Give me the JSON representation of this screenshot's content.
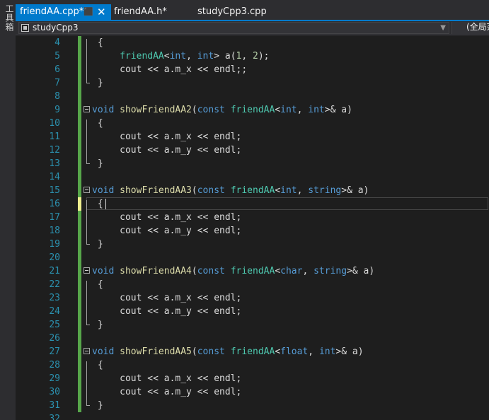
{
  "side_panel": {
    "toolbox_label": "工具箱"
  },
  "tabs": [
    {
      "label": "friendAA.cpp*",
      "active": true,
      "pin_icon": "pin-icon",
      "close_icon": "close-icon"
    },
    {
      "label": "friendAA.h*",
      "active": false
    },
    {
      "label": "studyCpp3.cpp",
      "active": false
    }
  ],
  "navbar": {
    "project": "studyCpp3",
    "scope": "(全局范围)"
  },
  "editor": {
    "lines": [
      {
        "n": "4",
        "code": [
          {
            "t": "{",
            "c": "p"
          }
        ]
      },
      {
        "n": "5",
        "code": [
          {
            "t": "    "
          },
          {
            "t": "friendAA",
            "c": "ty"
          },
          {
            "t": "<"
          },
          {
            "t": "int",
            "c": "kw"
          },
          {
            "t": ", "
          },
          {
            "t": "int",
            "c": "kw"
          },
          {
            "t": "> "
          },
          {
            "t": "a",
            "c": "mem"
          },
          {
            "t": "("
          },
          {
            "t": "1",
            "c": "num"
          },
          {
            "t": ", "
          },
          {
            "t": "2",
            "c": "num"
          },
          {
            "t": ");"
          }
        ]
      },
      {
        "n": "6",
        "code": [
          {
            "t": "    cout << a."
          },
          {
            "t": "m_x",
            "c": "mem"
          },
          {
            "t": " << endl;;"
          }
        ]
      },
      {
        "n": "7",
        "code": [
          {
            "t": "}"
          }
        ]
      },
      {
        "n": "8",
        "code": []
      },
      {
        "n": "9",
        "code": [
          {
            "t": "void",
            "c": "kw"
          },
          {
            "t": " "
          },
          {
            "t": "showFriendAA2",
            "c": "fn"
          },
          {
            "t": "("
          },
          {
            "t": "const",
            "c": "kw"
          },
          {
            "t": " "
          },
          {
            "t": "friendAA",
            "c": "ty"
          },
          {
            "t": "<"
          },
          {
            "t": "int",
            "c": "kw"
          },
          {
            "t": ", "
          },
          {
            "t": "int",
            "c": "kw"
          },
          {
            "t": ">& a)"
          }
        ]
      },
      {
        "n": "10",
        "code": [
          {
            "t": "{"
          }
        ]
      },
      {
        "n": "11",
        "code": [
          {
            "t": "    cout << a."
          },
          {
            "t": "m_x",
            "c": "mem"
          },
          {
            "t": " << endl;"
          }
        ]
      },
      {
        "n": "12",
        "code": [
          {
            "t": "    cout << a."
          },
          {
            "t": "m_y",
            "c": "mem"
          },
          {
            "t": " << endl;"
          }
        ]
      },
      {
        "n": "13",
        "code": [
          {
            "t": "}"
          }
        ]
      },
      {
        "n": "14",
        "code": []
      },
      {
        "n": "15",
        "code": [
          {
            "t": "void",
            "c": "kw"
          },
          {
            "t": " "
          },
          {
            "t": "showFriendAA3",
            "c": "fn"
          },
          {
            "t": "("
          },
          {
            "t": "const",
            "c": "kw"
          },
          {
            "t": " "
          },
          {
            "t": "friendAA",
            "c": "ty"
          },
          {
            "t": "<"
          },
          {
            "t": "int",
            "c": "kw"
          },
          {
            "t": ", "
          },
          {
            "t": "string",
            "c": "kw"
          },
          {
            "t": ">& a)"
          }
        ]
      },
      {
        "n": "16",
        "code": [
          {
            "t": "{"
          }
        ]
      },
      {
        "n": "17",
        "code": [
          {
            "t": "    cout << a."
          },
          {
            "t": "m_x",
            "c": "mem"
          },
          {
            "t": " << endl;"
          }
        ]
      },
      {
        "n": "18",
        "code": [
          {
            "t": "    cout << a."
          },
          {
            "t": "m_y",
            "c": "mem"
          },
          {
            "t": " << endl;"
          }
        ]
      },
      {
        "n": "19",
        "code": [
          {
            "t": "}"
          }
        ]
      },
      {
        "n": "20",
        "code": []
      },
      {
        "n": "21",
        "code": [
          {
            "t": "void",
            "c": "kw"
          },
          {
            "t": " "
          },
          {
            "t": "showFriendAA4",
            "c": "fn"
          },
          {
            "t": "("
          },
          {
            "t": "const",
            "c": "kw"
          },
          {
            "t": " "
          },
          {
            "t": "friendAA",
            "c": "ty"
          },
          {
            "t": "<"
          },
          {
            "t": "char",
            "c": "kw"
          },
          {
            "t": ", "
          },
          {
            "t": "string",
            "c": "kw"
          },
          {
            "t": ">& a)"
          }
        ]
      },
      {
        "n": "22",
        "code": [
          {
            "t": "{"
          }
        ]
      },
      {
        "n": "23",
        "code": [
          {
            "t": "    cout << a."
          },
          {
            "t": "m_x",
            "c": "mem"
          },
          {
            "t": " << endl;"
          }
        ]
      },
      {
        "n": "24",
        "code": [
          {
            "t": "    cout << a."
          },
          {
            "t": "m_y",
            "c": "mem"
          },
          {
            "t": " << endl;"
          }
        ]
      },
      {
        "n": "25",
        "code": [
          {
            "t": "}"
          }
        ]
      },
      {
        "n": "26",
        "code": []
      },
      {
        "n": "27",
        "code": [
          {
            "t": "void",
            "c": "kw"
          },
          {
            "t": " "
          },
          {
            "t": "showFriendAA5",
            "c": "fn"
          },
          {
            "t": "("
          },
          {
            "t": "const",
            "c": "kw"
          },
          {
            "t": " "
          },
          {
            "t": "friendAA",
            "c": "ty"
          },
          {
            "t": "<"
          },
          {
            "t": "float",
            "c": "kw"
          },
          {
            "t": ", "
          },
          {
            "t": "int",
            "c": "kw"
          },
          {
            "t": ">& a)"
          }
        ]
      },
      {
        "n": "28",
        "code": [
          {
            "t": "{"
          }
        ]
      },
      {
        "n": "29",
        "code": [
          {
            "t": "    cout << a."
          },
          {
            "t": "m_x",
            "c": "mem"
          },
          {
            "t": " << endl;"
          }
        ]
      },
      {
        "n": "30",
        "code": [
          {
            "t": "    cout << a."
          },
          {
            "t": "m_y",
            "c": "mem"
          },
          {
            "t": " << endl;"
          }
        ]
      },
      {
        "n": "31",
        "code": [
          {
            "t": "}"
          }
        ]
      },
      {
        "n": "32",
        "code": []
      }
    ],
    "current_line": "16",
    "colors": {
      "background": "#1e1e1e",
      "line_number": "#2b91af",
      "keyword": "#569cd6",
      "type": "#4ec9b0",
      "function": "#dcdcaa",
      "number": "#b5cea8",
      "text": "#dcdcdc",
      "changed_saved": "#57a64a",
      "changed_unsaved": "#efef8f",
      "accent": "#007acc"
    }
  }
}
